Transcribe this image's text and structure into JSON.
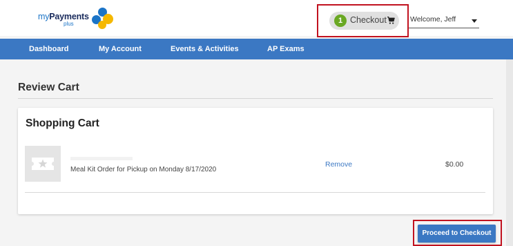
{
  "header": {
    "logo": {
      "word_my": "my",
      "word_payments": "Payments",
      "word_plus": "plus"
    },
    "checkout": {
      "count": "1",
      "label": "Checkout",
      "icon": "cart-icon"
    },
    "welcome": {
      "label": "Welcome, Jeff",
      "icon": "caret-down-icon"
    }
  },
  "nav": {
    "items": [
      {
        "label": "Dashboard"
      },
      {
        "label": "My Account"
      },
      {
        "label": "Events & Activities"
      },
      {
        "label": "AP Exams"
      }
    ]
  },
  "page": {
    "title": "Review Cart"
  },
  "cart": {
    "title": "Shopping Cart",
    "items": [
      {
        "description": "Meal Kit Order for Pickup on Monday 8/17/2020",
        "remove_label": "Remove",
        "price": "$0.00",
        "icon": "ticket-icon"
      }
    ],
    "proceed_label": "Proceed to Checkout"
  },
  "colors": {
    "nav_bg": "#3b78c3",
    "badge_green": "#6aa823",
    "highlight_red": "#c1121f",
    "logo_blue": "#1b74c7",
    "logo_yellow": "#f5b800"
  }
}
